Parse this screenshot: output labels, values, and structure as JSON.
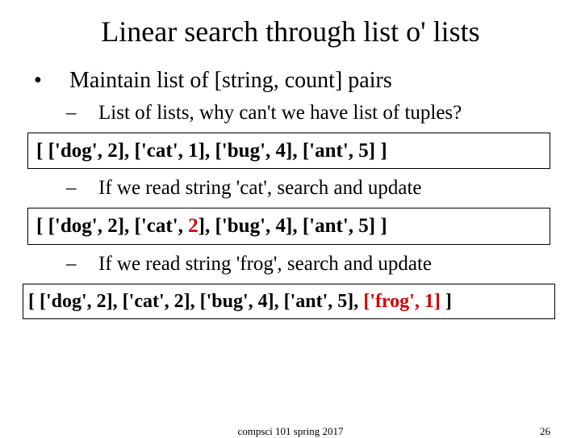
{
  "title": "Linear search through list o' lists",
  "l1": "Maintain list of [string, count] pairs",
  "l2a": "List of lists, why can't we have list of tuples?",
  "box1": {
    "a": "[ ['dog', 2], ['cat', 1], ['bug', 4], ['ant', 5] ]"
  },
  "l2b": "If we read string 'cat',  search and update",
  "box2": {
    "a": "[ ['dog', 2], ['cat', ",
    "red": "2",
    "b": "], ['bug', 4], ['ant', 5] ]"
  },
  "l2c": "If we read string 'frog', search and update",
  "box3": {
    "a": "[ ['dog', 2], ['cat', 2], ['bug', 4], ['ant', 5], ",
    "red": "['frog', 1]",
    "b": " ]"
  },
  "footer": {
    "center": "compsci 101 spring 2017",
    "page": "26"
  }
}
